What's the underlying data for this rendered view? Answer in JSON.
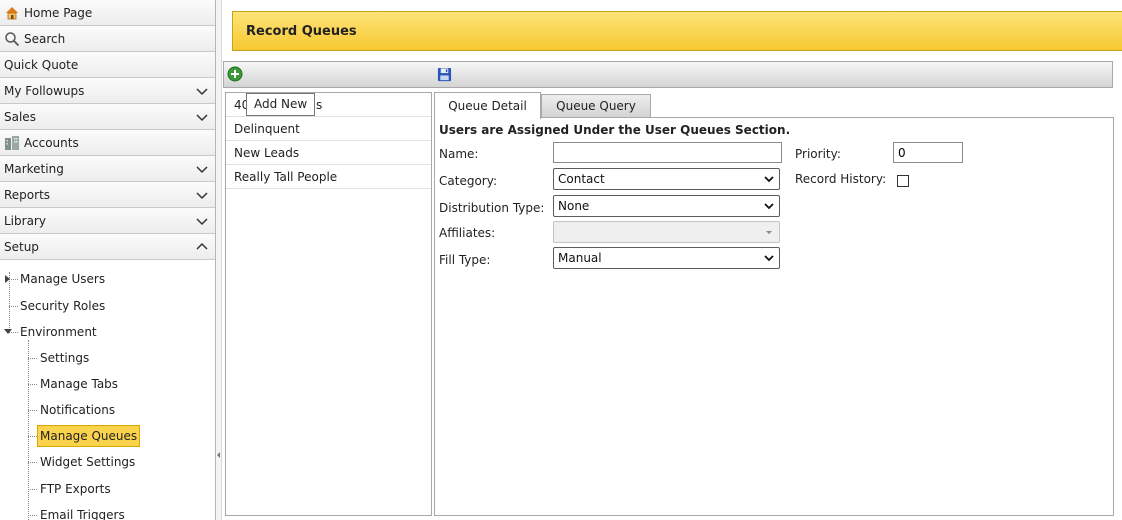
{
  "sidebar": {
    "nav": [
      {
        "label": "Home Page",
        "icon": "home-icon",
        "expandable": false
      },
      {
        "label": "Search",
        "icon": "search-icon",
        "expandable": false
      },
      {
        "label": "Quick Quote",
        "icon": "",
        "expandable": false
      },
      {
        "label": "My Followups",
        "icon": "",
        "expandable": true,
        "expanded": false
      },
      {
        "label": "Sales",
        "icon": "",
        "expandable": true,
        "expanded": false
      },
      {
        "label": "Accounts",
        "icon": "accounts-icon",
        "expandable": false
      },
      {
        "label": "Marketing",
        "icon": "",
        "expandable": true,
        "expanded": false
      },
      {
        "label": "Reports",
        "icon": "",
        "expandable": true,
        "expanded": false
      },
      {
        "label": "Library",
        "icon": "",
        "expandable": true,
        "expanded": false
      },
      {
        "label": "Setup",
        "icon": "",
        "expandable": true,
        "expanded": true
      }
    ],
    "tree": {
      "manage_users": "Manage Users",
      "security_roles": "Security Roles",
      "environment": "Environment",
      "children": [
        "Settings",
        "Manage Tabs",
        "Notifications",
        "Manage Queues",
        "Widget Settings",
        "FTP Exports",
        "Email Triggers"
      ],
      "selected": "Manage Queues"
    }
  },
  "header": {
    "title": "Record Queues"
  },
  "toolbar": {
    "add_new_tooltip": "Add New",
    "add_icon": "add-circle-icon",
    "save_icon": "save-disk-icon"
  },
  "queues": {
    "first_item_visible_start": "40",
    "first_item_visible_end": "s",
    "items": [
      "Delinquent",
      "New Leads",
      "Really Tall People"
    ]
  },
  "tabs": [
    {
      "label": "Queue Detail",
      "active": true
    },
    {
      "label": "Queue Query",
      "active": false
    }
  ],
  "form": {
    "heading": "Users are Assigned Under the User Queues Section.",
    "name_label": "Name:",
    "name_value": "",
    "category_label": "Category:",
    "category_value": "Contact",
    "distribution_label": "Distribution Type:",
    "distribution_value": "None",
    "affiliates_label": "Affiliates:",
    "affiliates_value": "",
    "fill_label": "Fill Type:",
    "fill_value": "Manual",
    "priority_label": "Priority:",
    "priority_value": "0",
    "record_history_label": "Record History:",
    "record_history_checked": false
  },
  "colors": {
    "title_bar": "#f7c830",
    "selected_node": "#fbd34c",
    "add_icon": "#3a9a3a",
    "save_icon": "#2a55b8"
  }
}
